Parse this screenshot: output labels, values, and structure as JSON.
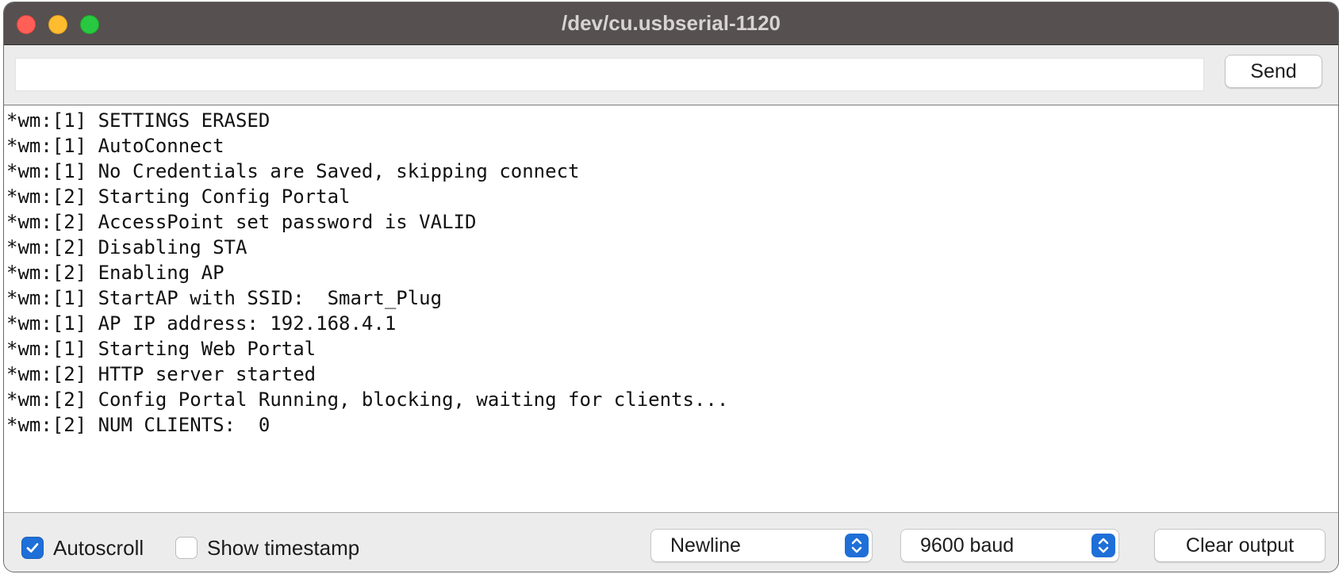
{
  "window": {
    "title": "/dev/cu.usbserial-1120"
  },
  "send_row": {
    "input_value": "",
    "input_placeholder": "",
    "send_label": "Send"
  },
  "output": {
    "lines": [
      "*wm:[1] SETTINGS ERASED",
      "*wm:[1] AutoConnect",
      "*wm:[1] No Credentials are Saved, skipping connect",
      "*wm:[2] Starting Config Portal",
      "*wm:[2] AccessPoint set password is VALID",
      "*wm:[2] Disabling STA",
      "*wm:[2] Enabling AP",
      "*wm:[1] StartAP with SSID:  Smart_Plug",
      "*wm:[1] AP IP address: 192.168.4.1",
      "*wm:[1] Starting Web Portal",
      "*wm:[2] HTTP server started",
      "*wm:[2] Config Portal Running, blocking, waiting for clients...",
      "*wm:[2] NUM CLIENTS:  0"
    ]
  },
  "bottom_bar": {
    "autoscroll_label": "Autoscroll",
    "autoscroll_checked": true,
    "timestamp_label": "Show timestamp",
    "timestamp_checked": false,
    "line_ending_selected": "Newline",
    "baud_selected": "9600 baud",
    "clear_label": "Clear output"
  },
  "colors": {
    "titlebar": "#565050",
    "accent": "#1f6fd8",
    "close": "#ff5f57",
    "minimize": "#febc2e",
    "zoom": "#28c840"
  },
  "icons": {
    "autoscroll_check": "checkmark-icon",
    "select_stepper": "chevron-up-down-icon"
  }
}
